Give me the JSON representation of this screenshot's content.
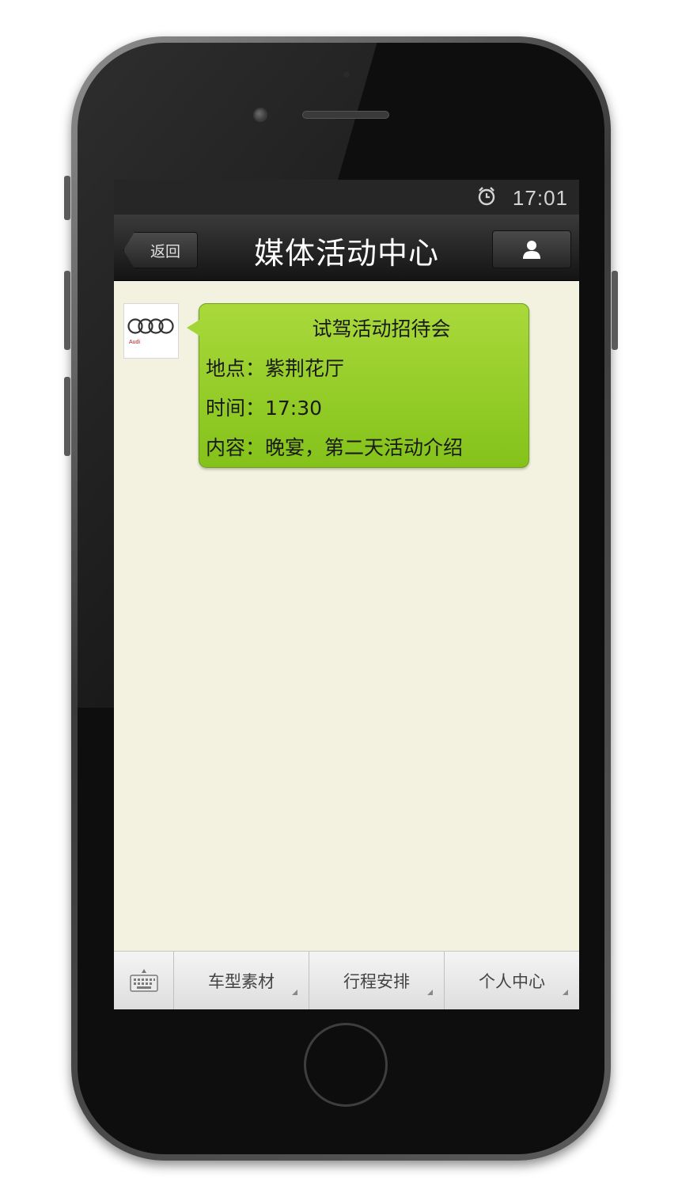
{
  "status_bar": {
    "time": "17:01",
    "alarm_icon": "alarm-clock-icon"
  },
  "nav": {
    "back_label": "返回",
    "title": "媒体活动中心",
    "profile_icon": "user-icon"
  },
  "message": {
    "sender_brand": "Audi",
    "avatar_icon": "audi-rings-logo",
    "title": "试驾活动招待会",
    "location": "地点：紫荆花厅",
    "time": "时间：17:30",
    "content": "内容：晚宴，第二天活动介绍"
  },
  "bottom_menu": {
    "keyboard_icon": "keyboard-icon",
    "items": [
      {
        "label": "车型素材"
      },
      {
        "label": "行程安排"
      },
      {
        "label": "个人中心"
      }
    ]
  },
  "colors": {
    "bubble": "#98cd2c",
    "chat_background": "#f3f2e1",
    "nav_bar": "#262626"
  }
}
